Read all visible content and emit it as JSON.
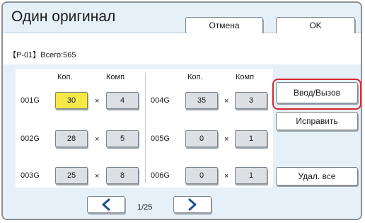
{
  "header": {
    "title": "Один оригинал",
    "cancel_label": "Отмена",
    "ok_label": "OK"
  },
  "info": {
    "text": "【P-01】Всего:565"
  },
  "columns": {
    "copies_header": "Коп.",
    "sets_header": "Комп"
  },
  "multiply_sign": "×",
  "groups": [
    {
      "label": "001G",
      "copies": "30",
      "sets": "4"
    },
    {
      "label": "002G",
      "copies": "28",
      "sets": "5"
    },
    {
      "label": "003G",
      "copies": "25",
      "sets": "8"
    },
    {
      "label": "004G",
      "copies": "35",
      "sets": "3"
    },
    {
      "label": "005G",
      "copies": "0",
      "sets": "1"
    },
    {
      "label": "006G",
      "copies": "0",
      "sets": "1"
    }
  ],
  "actions": {
    "enter_recall_label": "Ввод/Вызов",
    "edit_label": "Исправить",
    "delete_all_label": "Удал. все"
  },
  "pagination": {
    "current": "1/25"
  },
  "highlight_color": "#d8252f",
  "selected_field_color": "#f5e94a"
}
